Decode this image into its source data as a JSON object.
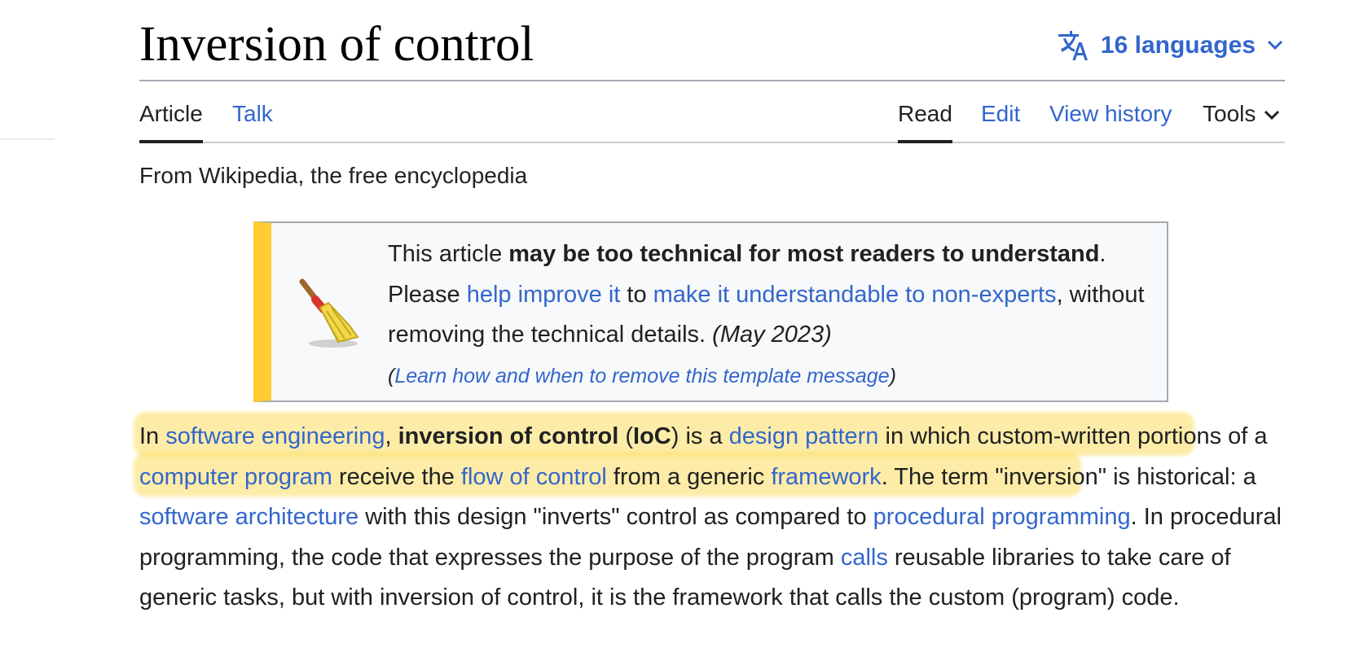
{
  "page": {
    "title": "Inversion of control",
    "languages_label": "16 languages"
  },
  "tabs": {
    "article": "Article",
    "talk": "Talk",
    "read": "Read",
    "edit": "Edit",
    "view_history": "View history",
    "tools": "Tools"
  },
  "tagline": "From Wikipedia, the free encyclopedia",
  "notice": {
    "icon": "broom-icon",
    "t1": "This article ",
    "b1": "may be too technical for most readers to understand",
    "t2": ". Please ",
    "l1": "help improve it",
    "t3": " to ",
    "l2": "make it understandable to non-experts",
    "t4": ", without removing the technical details. ",
    "date": "(May 2023)",
    "paren_open": "(",
    "learn": "Learn how and when to remove this template message",
    "paren_close": ")"
  },
  "intro": {
    "s1": "In ",
    "l1": "software engineering",
    "s2": ", ",
    "b1": "inversion of control",
    "s3": " (",
    "b2": "IoC",
    "s4": ") is a ",
    "l2": "design pattern",
    "s5": " in which custom-written portions of a ",
    "l3": "computer program",
    "s6": " receive the ",
    "l4": "flow of control",
    "s7": " from a generic ",
    "l5": "framework",
    "s8": ". The term \"inversion\" is historical: a ",
    "l6": "software architecture",
    "s9": " with this design \"inverts\" control as compared to ",
    "l7": "procedural programming",
    "s10": ". In procedural programming, the code that expresses the purpose of the program ",
    "l8": "calls",
    "s11": " reusable libraries to take care of generic tasks, but with inversion of control, it is the framework that calls the custom (program) code."
  },
  "colors": {
    "link": "#3366cc",
    "text": "#202122",
    "notice_stripe": "#ffcc33",
    "highlight": "#fad43c"
  }
}
